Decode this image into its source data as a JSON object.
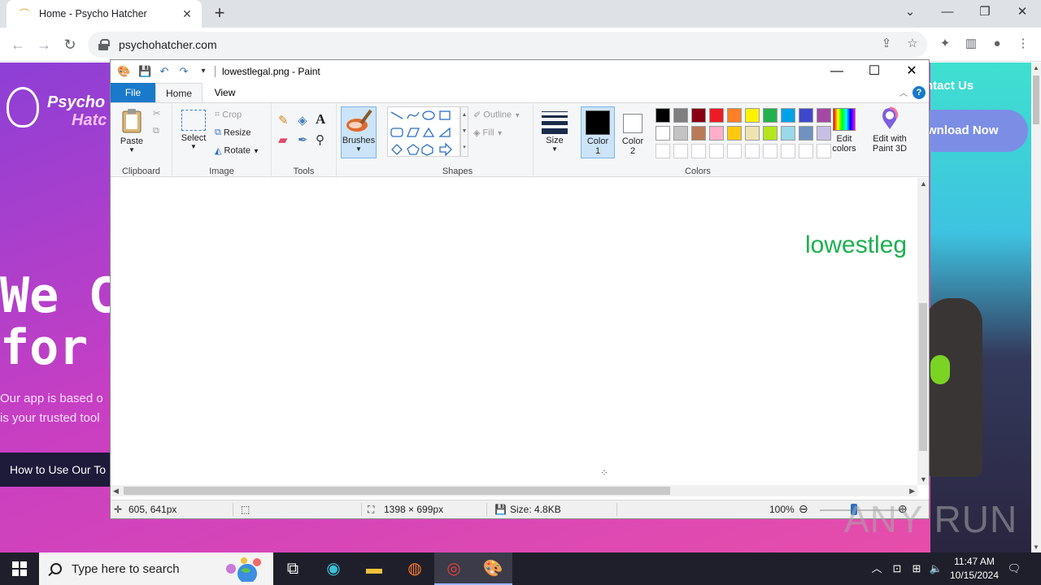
{
  "browser": {
    "tab_title": "Home - Psycho Hatcher",
    "url": "psychohatcher.com"
  },
  "website": {
    "logo_line1": "Psycho",
    "logo_line2": "Hatc",
    "nav_contact": "ntact Us",
    "download_btn": "wnload Now",
    "hero": "We C\nfor Y",
    "hero_sub": "Our app is based o\nis your trusted tool",
    "how_btn": "How to Use Our To"
  },
  "paint": {
    "title": "lowestlegal.png - Paint",
    "tabs": {
      "file": "File",
      "home": "Home",
      "view": "View"
    },
    "clipboard": {
      "paste": "Paste",
      "label": "Clipboard"
    },
    "image": {
      "select": "Select",
      "crop": "Crop",
      "resize": "Resize",
      "rotate": "Rotate",
      "label": "Image"
    },
    "tools": {
      "label": "Tools"
    },
    "brushes": "Brushes",
    "shapes": {
      "outline": "Outline",
      "fill": "Fill",
      "label": "Shapes"
    },
    "size": "Size",
    "color1": "Color\n1",
    "color2": "Color\n2",
    "colors_label": "Colors",
    "edit_colors": "Edit\ncolors",
    "paint3d": "Edit with\nPaint 3D",
    "palette_row1": [
      "#000000",
      "#7f7f7f",
      "#880015",
      "#ed1c24",
      "#ff7f27",
      "#fff200",
      "#22b14c",
      "#00a2e8",
      "#3f48cc",
      "#a349a4"
    ],
    "palette_row2": [
      "#ffffff",
      "#c3c3c3",
      "#b97a57",
      "#ffaec9",
      "#ffc90e",
      "#efe4b0",
      "#b5e61d",
      "#99d9ea",
      "#7092be",
      "#c8bfe7"
    ],
    "canvas_text": "lowestleg",
    "status": {
      "cursor": "605, 641px",
      "dimensions": "1398 × 699px",
      "size": "Size: 4.8KB",
      "zoom": "100%"
    }
  },
  "taskbar": {
    "search_placeholder": "Type here to search",
    "time": "11:47 AM",
    "date": "10/15/2024"
  },
  "watermark": "ANY  RUN"
}
